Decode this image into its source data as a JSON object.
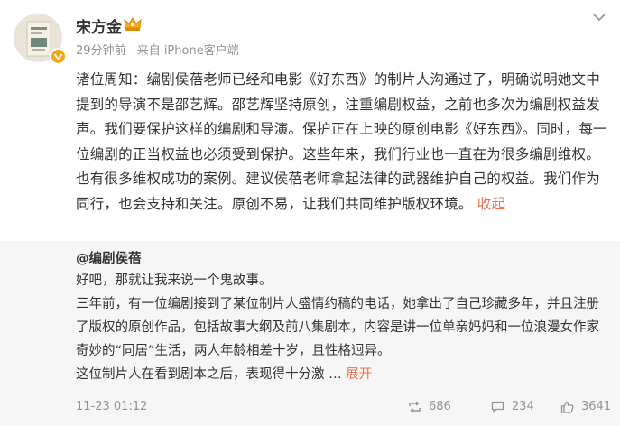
{
  "post": {
    "author": "宋方金",
    "time": "29分钟前",
    "source": "来自 iPhone客户端",
    "text": "诸位周知：编剧侯蓓老师已经和电影《好东西》的制片人沟通过了，明确说明她文中提到的导演不是邵艺辉。邵艺辉坚持原创，注重编剧权益，之前也多次为编剧权益发声。我们要保护这样的编剧和导演。保护正在上映的原创电影《好东西》。同时，每一位编剧的正当权益也必须受到保护。这些年来，我们行业也一直在为很多编剧维权。也有很多维权成功的案例。建议侯蓓老师拿起法律的武器维护自己的权益。我们作为同行，也会支持和关注。原创不易，让我们共同维护版权环境。",
    "collapse_label": "收起"
  },
  "repost": {
    "author": "@编剧侯蓓",
    "paragraphs": [
      "好吧，那就让我来说一个鬼故事。",
      "三年前，有一位编剧接到了某位制片人盛情约稿的电话，她拿出了自己珍藏多年，并且注册了版权的原创作品，包括故事大纲及前八集剧本，内容是讲一位单亲妈妈和一位浪漫女作家奇妙的“同居”生活，两人年龄相差十岁，且性格迥异。",
      "这位制片人在看到剧本之后，表现得十分激 …"
    ],
    "expand_label": "展开",
    "time": "11-23 01:12",
    "reposts": "686",
    "comments": "234",
    "likes": "3641"
  },
  "colors": {
    "link": "#eb7350",
    "meta": "#939393",
    "quote_bg": "#f6f6f6",
    "badge": "#f2a71b"
  },
  "icons": {
    "menu": "chevron-down-icon",
    "repost": "repost-icon",
    "comment": "comment-icon",
    "like": "like-icon"
  }
}
